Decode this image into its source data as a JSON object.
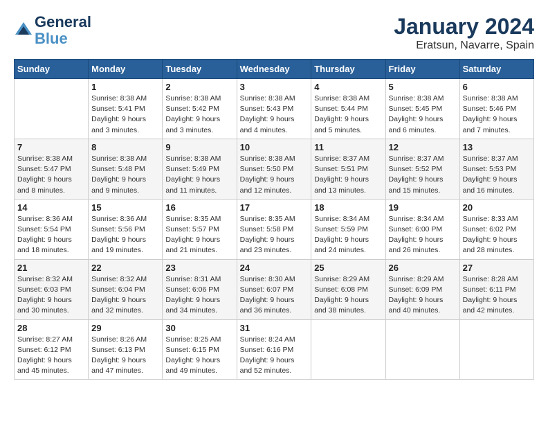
{
  "header": {
    "logo_line1": "General",
    "logo_line2": "Blue",
    "month": "January 2024",
    "location": "Eratsun, Navarre, Spain"
  },
  "weekdays": [
    "Sunday",
    "Monday",
    "Tuesday",
    "Wednesday",
    "Thursday",
    "Friday",
    "Saturday"
  ],
  "weeks": [
    [
      {
        "day": "",
        "sunrise": "",
        "sunset": "",
        "daylight": ""
      },
      {
        "day": "1",
        "sunrise": "Sunrise: 8:38 AM",
        "sunset": "Sunset: 5:41 PM",
        "daylight": "Daylight: 9 hours and 3 minutes."
      },
      {
        "day": "2",
        "sunrise": "Sunrise: 8:38 AM",
        "sunset": "Sunset: 5:42 PM",
        "daylight": "Daylight: 9 hours and 3 minutes."
      },
      {
        "day": "3",
        "sunrise": "Sunrise: 8:38 AM",
        "sunset": "Sunset: 5:43 PM",
        "daylight": "Daylight: 9 hours and 4 minutes."
      },
      {
        "day": "4",
        "sunrise": "Sunrise: 8:38 AM",
        "sunset": "Sunset: 5:44 PM",
        "daylight": "Daylight: 9 hours and 5 minutes."
      },
      {
        "day": "5",
        "sunrise": "Sunrise: 8:38 AM",
        "sunset": "Sunset: 5:45 PM",
        "daylight": "Daylight: 9 hours and 6 minutes."
      },
      {
        "day": "6",
        "sunrise": "Sunrise: 8:38 AM",
        "sunset": "Sunset: 5:46 PM",
        "daylight": "Daylight: 9 hours and 7 minutes."
      }
    ],
    [
      {
        "day": "7",
        "sunrise": "Sunrise: 8:38 AM",
        "sunset": "Sunset: 5:47 PM",
        "daylight": "Daylight: 9 hours and 8 minutes."
      },
      {
        "day": "8",
        "sunrise": "Sunrise: 8:38 AM",
        "sunset": "Sunset: 5:48 PM",
        "daylight": "Daylight: 9 hours and 9 minutes."
      },
      {
        "day": "9",
        "sunrise": "Sunrise: 8:38 AM",
        "sunset": "Sunset: 5:49 PM",
        "daylight": "Daylight: 9 hours and 11 minutes."
      },
      {
        "day": "10",
        "sunrise": "Sunrise: 8:38 AM",
        "sunset": "Sunset: 5:50 PM",
        "daylight": "Daylight: 9 hours and 12 minutes."
      },
      {
        "day": "11",
        "sunrise": "Sunrise: 8:37 AM",
        "sunset": "Sunset: 5:51 PM",
        "daylight": "Daylight: 9 hours and 13 minutes."
      },
      {
        "day": "12",
        "sunrise": "Sunrise: 8:37 AM",
        "sunset": "Sunset: 5:52 PM",
        "daylight": "Daylight: 9 hours and 15 minutes."
      },
      {
        "day": "13",
        "sunrise": "Sunrise: 8:37 AM",
        "sunset": "Sunset: 5:53 PM",
        "daylight": "Daylight: 9 hours and 16 minutes."
      }
    ],
    [
      {
        "day": "14",
        "sunrise": "Sunrise: 8:36 AM",
        "sunset": "Sunset: 5:54 PM",
        "daylight": "Daylight: 9 hours and 18 minutes."
      },
      {
        "day": "15",
        "sunrise": "Sunrise: 8:36 AM",
        "sunset": "Sunset: 5:56 PM",
        "daylight": "Daylight: 9 hours and 19 minutes."
      },
      {
        "day": "16",
        "sunrise": "Sunrise: 8:35 AM",
        "sunset": "Sunset: 5:57 PM",
        "daylight": "Daylight: 9 hours and 21 minutes."
      },
      {
        "day": "17",
        "sunrise": "Sunrise: 8:35 AM",
        "sunset": "Sunset: 5:58 PM",
        "daylight": "Daylight: 9 hours and 23 minutes."
      },
      {
        "day": "18",
        "sunrise": "Sunrise: 8:34 AM",
        "sunset": "Sunset: 5:59 PM",
        "daylight": "Daylight: 9 hours and 24 minutes."
      },
      {
        "day": "19",
        "sunrise": "Sunrise: 8:34 AM",
        "sunset": "Sunset: 6:00 PM",
        "daylight": "Daylight: 9 hours and 26 minutes."
      },
      {
        "day": "20",
        "sunrise": "Sunrise: 8:33 AM",
        "sunset": "Sunset: 6:02 PM",
        "daylight": "Daylight: 9 hours and 28 minutes."
      }
    ],
    [
      {
        "day": "21",
        "sunrise": "Sunrise: 8:32 AM",
        "sunset": "Sunset: 6:03 PM",
        "daylight": "Daylight: 9 hours and 30 minutes."
      },
      {
        "day": "22",
        "sunrise": "Sunrise: 8:32 AM",
        "sunset": "Sunset: 6:04 PM",
        "daylight": "Daylight: 9 hours and 32 minutes."
      },
      {
        "day": "23",
        "sunrise": "Sunrise: 8:31 AM",
        "sunset": "Sunset: 6:06 PM",
        "daylight": "Daylight: 9 hours and 34 minutes."
      },
      {
        "day": "24",
        "sunrise": "Sunrise: 8:30 AM",
        "sunset": "Sunset: 6:07 PM",
        "daylight": "Daylight: 9 hours and 36 minutes."
      },
      {
        "day": "25",
        "sunrise": "Sunrise: 8:29 AM",
        "sunset": "Sunset: 6:08 PM",
        "daylight": "Daylight: 9 hours and 38 minutes."
      },
      {
        "day": "26",
        "sunrise": "Sunrise: 8:29 AM",
        "sunset": "Sunset: 6:09 PM",
        "daylight": "Daylight: 9 hours and 40 minutes."
      },
      {
        "day": "27",
        "sunrise": "Sunrise: 8:28 AM",
        "sunset": "Sunset: 6:11 PM",
        "daylight": "Daylight: 9 hours and 42 minutes."
      }
    ],
    [
      {
        "day": "28",
        "sunrise": "Sunrise: 8:27 AM",
        "sunset": "Sunset: 6:12 PM",
        "daylight": "Daylight: 9 hours and 45 minutes."
      },
      {
        "day": "29",
        "sunrise": "Sunrise: 8:26 AM",
        "sunset": "Sunset: 6:13 PM",
        "daylight": "Daylight: 9 hours and 47 minutes."
      },
      {
        "day": "30",
        "sunrise": "Sunrise: 8:25 AM",
        "sunset": "Sunset: 6:15 PM",
        "daylight": "Daylight: 9 hours and 49 minutes."
      },
      {
        "day": "31",
        "sunrise": "Sunrise: 8:24 AM",
        "sunset": "Sunset: 6:16 PM",
        "daylight": "Daylight: 9 hours and 52 minutes."
      },
      {
        "day": "",
        "sunrise": "",
        "sunset": "",
        "daylight": ""
      },
      {
        "day": "",
        "sunrise": "",
        "sunset": "",
        "daylight": ""
      },
      {
        "day": "",
        "sunrise": "",
        "sunset": "",
        "daylight": ""
      }
    ]
  ]
}
